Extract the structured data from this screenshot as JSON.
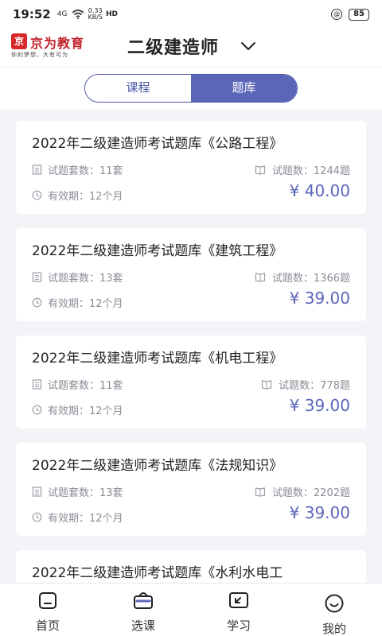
{
  "status_bar": {
    "time": "19:52",
    "signal": "4G",
    "speed_value": "0.33",
    "speed_unit": "KB/S",
    "hd": "HD",
    "battery": "85"
  },
  "header": {
    "brand_name": "京为教育",
    "brand_mark": "京",
    "slogan": "你的梦想，大有可为",
    "title": "二级建造师"
  },
  "tabs": [
    {
      "label": "课程",
      "active": false
    },
    {
      "label": "题库",
      "active": true
    }
  ],
  "labels": {
    "sets_label": "试题套数：",
    "questions_label": "试题数：",
    "validity_label": "有效期：",
    "currency": "¥ "
  },
  "cards": [
    {
      "title": "2022年二级建造师考试题库《公路工程》",
      "sets": "11套",
      "questions": "1244题",
      "validity": "12个月",
      "price": "40.00"
    },
    {
      "title": "2022年二级建造师考试题库《建筑工程》",
      "sets": "13套",
      "questions": "1366题",
      "validity": "12个月",
      "price": "39.00"
    },
    {
      "title": "2022年二级建造师考试题库《机电工程》",
      "sets": "11套",
      "questions": "778题",
      "validity": "12个月",
      "price": "39.00"
    },
    {
      "title": "2022年二级建造师考试题库《法规知识》",
      "sets": "13套",
      "questions": "2202题",
      "validity": "12个月",
      "price": "39.00"
    },
    {
      "title": "2022年二级建造师考试题库《水利水电工"
    }
  ],
  "bottom_nav": [
    {
      "label": "首页",
      "icon": "home-icon"
    },
    {
      "label": "选课",
      "icon": "basket-icon"
    },
    {
      "label": "学习",
      "icon": "study-icon"
    },
    {
      "label": "我的",
      "icon": "smiley-icon"
    }
  ],
  "colors": {
    "accent": "#5b66b9",
    "brand_red": "#c0232b",
    "muted_text": "#8a8d96",
    "background": "#f3f4f8"
  }
}
